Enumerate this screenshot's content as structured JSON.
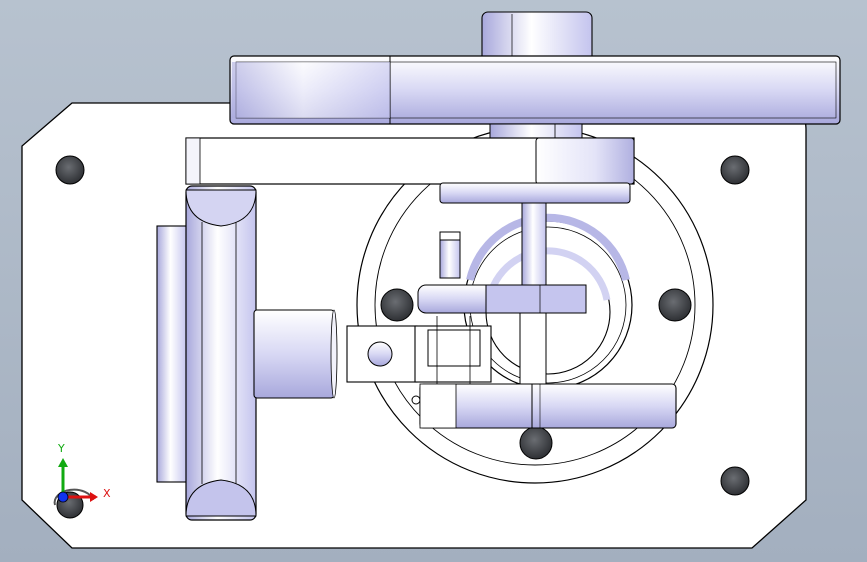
{
  "viewport": {
    "background_top": "#b7c2cf",
    "background_bottom": "#a3afbf",
    "model_fill": "#ffffff",
    "model_edge": "#000000",
    "hole_fill": "#4a4d52",
    "shade_color": "#c8c8f0"
  },
  "triad": {
    "x_label": "X",
    "y_label": "Y",
    "x_color": "#dd1111",
    "y_color": "#11aa11",
    "z_color": "#1133ee"
  }
}
